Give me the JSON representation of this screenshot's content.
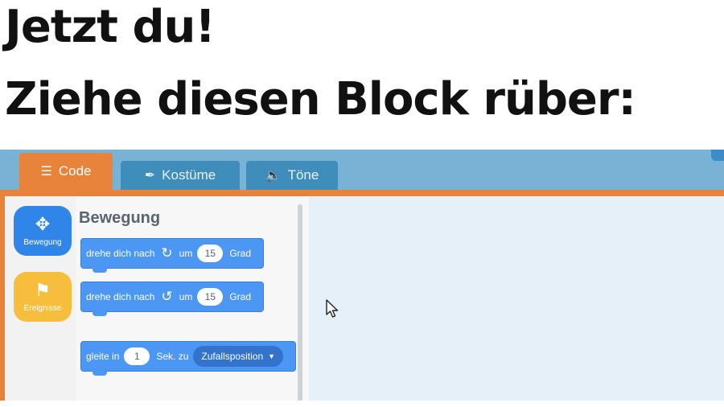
{
  "heading": {
    "line1": "Jetzt du!",
    "line2": "Ziehe diesen Block rüber:"
  },
  "tabs": [
    {
      "label": "Code",
      "icon": "code-icon",
      "active": true
    },
    {
      "label": "Kostüme",
      "icon": "brush-icon",
      "active": false
    },
    {
      "label": "Töne",
      "icon": "speaker-icon",
      "active": false
    }
  ],
  "categories": [
    {
      "label": "Bewegung",
      "icon": "move-arrows-icon",
      "color": "#2f86e8"
    },
    {
      "label": "Ereignisse",
      "icon": "flag-icon",
      "color": "#f7be3d"
    }
  ],
  "palette": {
    "title": "Bewegung",
    "blocks": [
      {
        "prefix": "drehe dich nach",
        "icon": "rotate-right-icon",
        "mid": "um",
        "value": "15",
        "suffix": "Grad"
      },
      {
        "prefix": "drehe dich nach",
        "icon": "rotate-left-icon",
        "mid": "um",
        "value": "15",
        "suffix": "Grad"
      },
      {
        "prefix": "gleite in",
        "value": "1",
        "mid": "Sek. zu",
        "dropdown": "Zufallsposition"
      }
    ]
  },
  "colors": {
    "accent": "#e7833a",
    "motion": "#4c97f3",
    "tab_inactive": "#3f8dba"
  }
}
